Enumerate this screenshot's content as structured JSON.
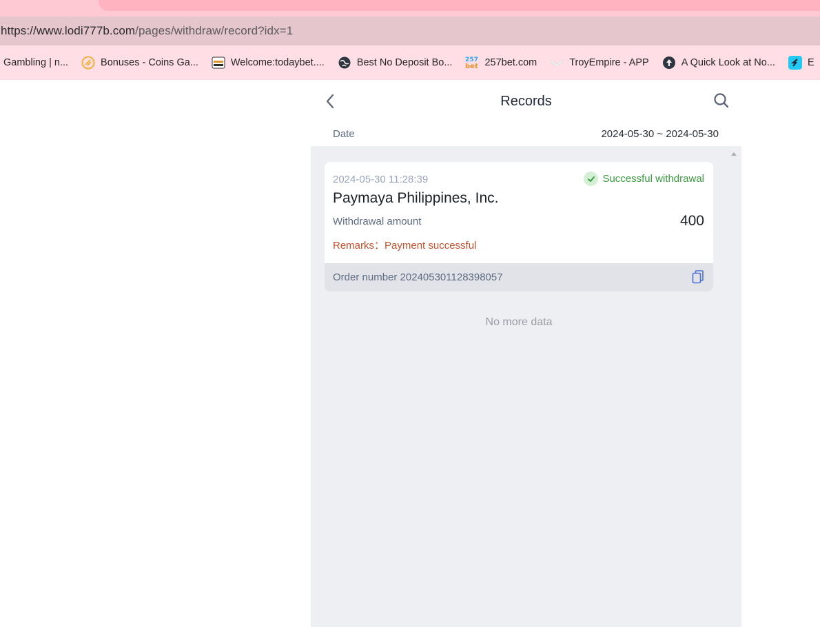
{
  "browser": {
    "url_prefix": "https://www.lodi777b.com",
    "url_path": "/pages/withdraw/record?idx=1",
    "bookmarks": [
      {
        "label": "Gambling | n...",
        "icon": "none"
      },
      {
        "label": "Bonuses - Coins Ga...",
        "icon": "coins-icon"
      },
      {
        "label": "Welcome:todaybet....",
        "icon": "todaybet-icon"
      },
      {
        "label": "Best No Deposit Bo...",
        "icon": "globe-icon"
      },
      {
        "label": "257bet.com",
        "icon": "257bet-icon"
      },
      {
        "label": "TroyEmpire - APP",
        "icon": "troy-icon"
      },
      {
        "label": "A Quick Look at No...",
        "icon": "spade-icon"
      },
      {
        "label": "E",
        "icon": "s-logo-icon"
      }
    ],
    "accent_color": "#ffb3c1"
  },
  "header": {
    "title": "Records",
    "date_label": "Date",
    "date_range": "2024-05-30 ~ 2024-05-30"
  },
  "record": {
    "time": "2024-05-30 11:28:39",
    "status": "Successful withdrawal",
    "channel": "Paymaya Philippines, Inc.",
    "amount_label": "Withdrawal amount",
    "amount": "400",
    "remarks": "Remarks：Payment successful",
    "order": "Order number 202405301128398057"
  },
  "footer": {
    "no_more": "No more data"
  },
  "colors": {
    "success": "#3a9a3e",
    "remark": "#c2502c",
    "muted": "#5d6b82"
  }
}
